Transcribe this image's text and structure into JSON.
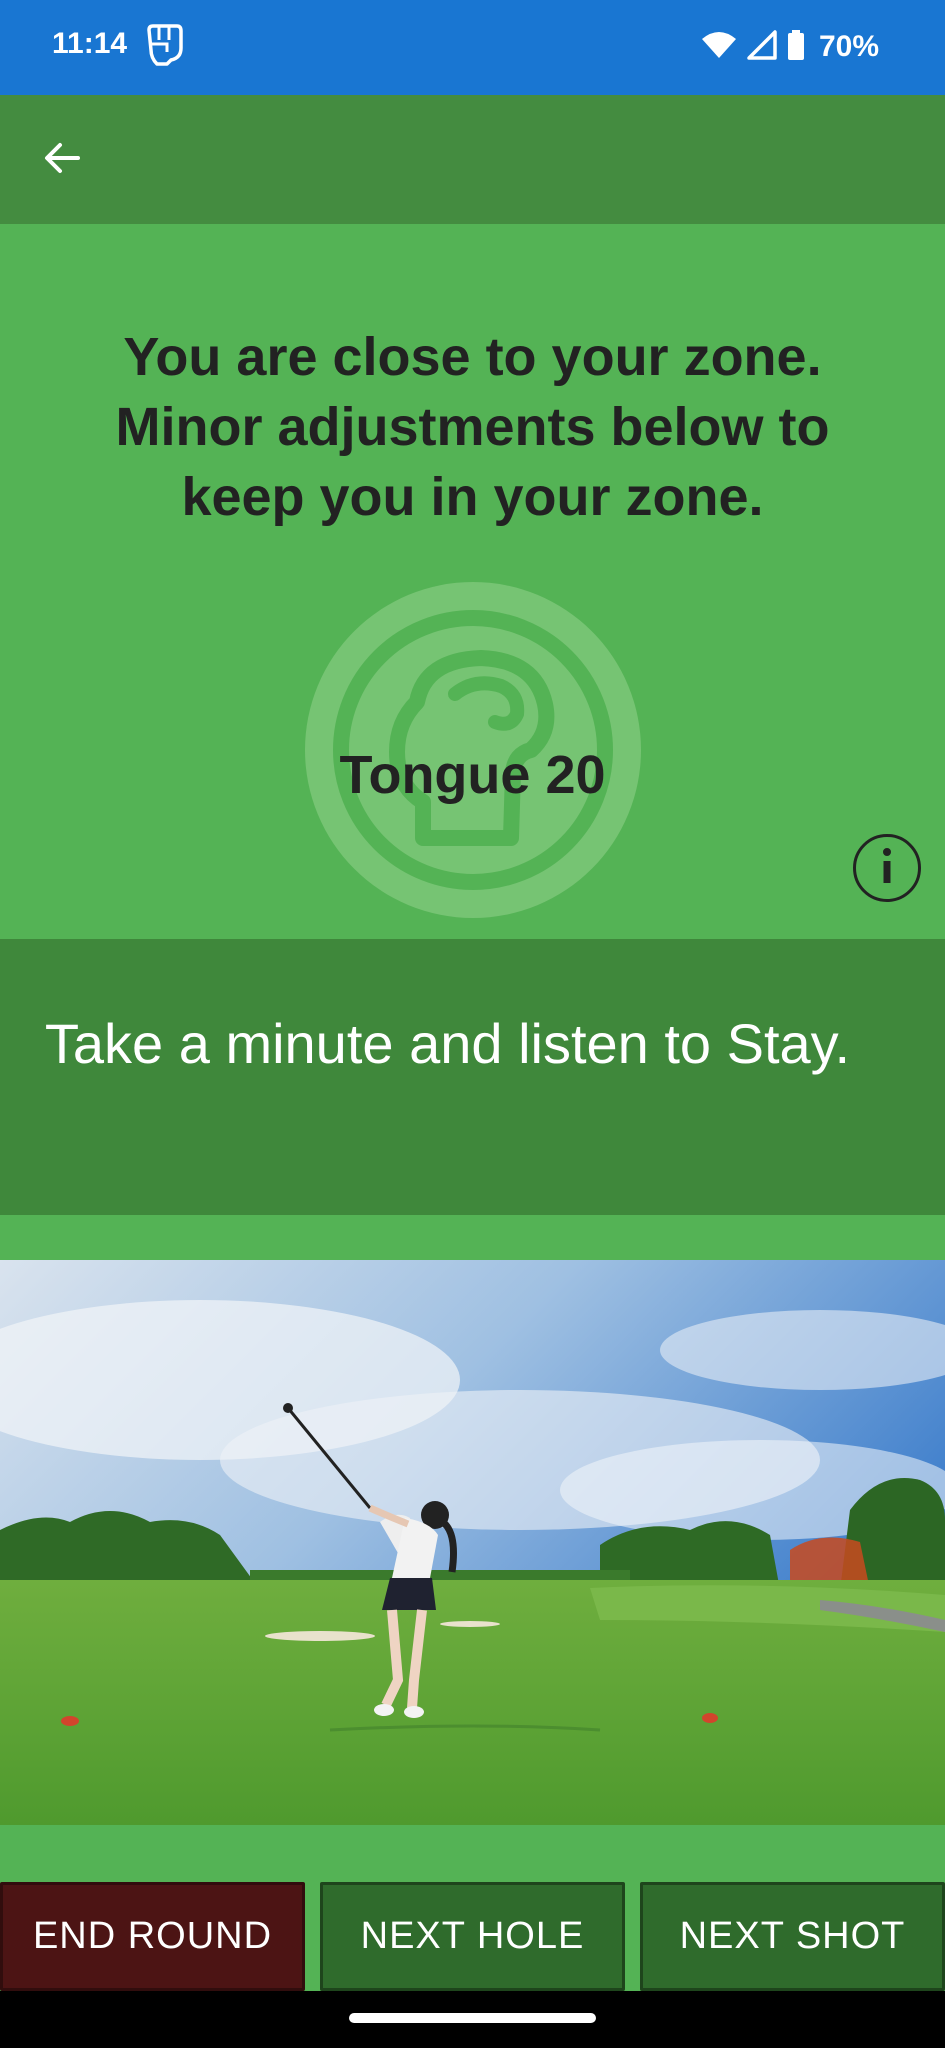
{
  "status_bar": {
    "time": "11:14",
    "battery": "70%",
    "icons": [
      "fist-app-icon",
      "wifi-icon",
      "cell-signal-icon",
      "battery-icon"
    ]
  },
  "app_bar": {
    "back_icon": "arrow-left-icon"
  },
  "zone": {
    "message": "You are close to your zone. Minor adjustments below to keep you in your zone.",
    "metric": "Tongue 20",
    "emblem_icon": "head-profile-icon",
    "info_icon": "info-icon"
  },
  "instruction": {
    "text": "Take a minute and listen to Stay."
  },
  "hero": {
    "image": "golfer-teeing-off-on-course"
  },
  "actions": {
    "end_round": "END ROUND",
    "next_hole": "NEXT HOLE",
    "next_shot": "NEXT SHOT"
  },
  "colors": {
    "status_bar": "#1976d2",
    "app_bar": "#448c40",
    "zone_bg": "#54b355",
    "instruction_bg": "#3f883b",
    "end_button": "#4c1414",
    "green_button": "#2f6b2c"
  }
}
